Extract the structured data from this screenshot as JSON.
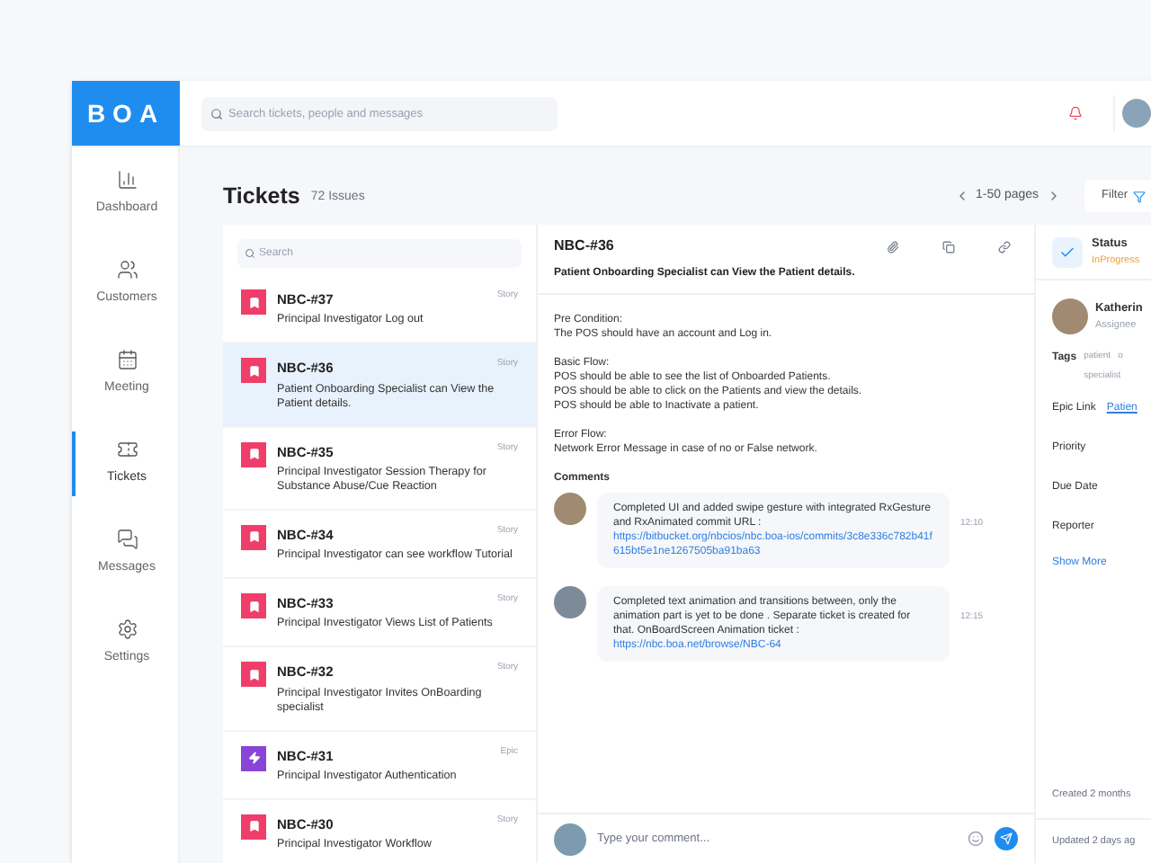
{
  "header": {
    "logo": "BOA",
    "search_placeholder": "Search tickets, people and messages"
  },
  "sidebar": [
    {
      "label": "Dashboard",
      "kind": "chart",
      "selected": false
    },
    {
      "label": "Customers",
      "kind": "users",
      "selected": false
    },
    {
      "label": "Meeting",
      "kind": "calendar",
      "selected": false
    },
    {
      "label": "Tickets",
      "kind": "ticket",
      "selected": true
    },
    {
      "label": "Messages",
      "kind": "messages",
      "selected": false
    },
    {
      "label": "Settings",
      "kind": "settings",
      "selected": false
    }
  ],
  "page": {
    "title": "Tickets",
    "count": "72 Issues",
    "pagination": "1-50 pages",
    "filter": "Filter"
  },
  "list": {
    "search_placeholder": "Search",
    "tickets": [
      {
        "id": "NBC-#37",
        "title": "Principal Investigator Log out",
        "type": "Story",
        "kind": "story",
        "selected": false
      },
      {
        "id": "NBC-#36",
        "title": "Patient Onboarding Specialist can View the Patient details.",
        "type": "Story",
        "kind": "story",
        "selected": true
      },
      {
        "id": "NBC-#35",
        "title": "Principal Investigator Session Therapy for Substance Abuse/Cue Reaction",
        "type": "Story",
        "kind": "story",
        "selected": false
      },
      {
        "id": "NBC-#34",
        "title": "Principal Investigator can see workflow Tutorial",
        "type": "Story",
        "kind": "story",
        "selected": false
      },
      {
        "id": "NBC-#33",
        "title": "Principal Investigator Views List of Patients",
        "type": "Story",
        "kind": "story",
        "selected": false
      },
      {
        "id": "NBC-#32",
        "title": "Principal Investigator Invites OnBoarding specialist",
        "type": "Story",
        "kind": "story",
        "selected": false
      },
      {
        "id": "NBC-#31",
        "title": "Principal Investigator Authentication",
        "type": "Epic",
        "kind": "epic",
        "selected": false
      },
      {
        "id": "NBC-#30",
        "title": "Principal Investigator Workflow",
        "type": "Story",
        "kind": "story",
        "selected": false
      }
    ]
  },
  "detail": {
    "id": "NBC-#36",
    "title": "Patient Onboarding Specialist can View the Patient details.",
    "sections": [
      {
        "heading": "Pre Condition:",
        "lines": [
          "The POS should have an account and Log in."
        ]
      },
      {
        "heading": "Basic Flow:",
        "lines": [
          "POS should be able to see the list of Onboarded Patients.",
          "POS should be able to click on the Patients and view the details.",
          "POS should be able to Inactivate a patient."
        ]
      },
      {
        "heading": "Error Flow:",
        "lines": [
          "Network Error Message in case of no or False network."
        ]
      }
    ],
    "comments_heading": "Comments",
    "comments": [
      {
        "text": "Completed UI and added swipe gesture with integrated RxGesture and RxAnimated commit URL :",
        "link": "https://bitbucket.org/nbcios/nbc.boa-ios/commits/3c8e336c782b41f615bt5e1ne1267505ba91ba63",
        "time": "12:10"
      },
      {
        "text": "Completed text animation and transitions between, only the animation part is yet to be done . Separate ticket is created for that. OnBoardScreen Animation ticket :",
        "link": "https://nbc.boa.net/browse/NBC-64",
        "time": "12:15"
      }
    ],
    "comment_placeholder": "Type your comment..."
  },
  "side": {
    "status_label": "Status",
    "status_value": "InProgress",
    "status_checked": true,
    "assignee": "Katherin",
    "assignee_role": "Assignee",
    "tags_label": "Tags",
    "tags": [
      "patient",
      "o",
      "specialist"
    ],
    "fields": [
      {
        "label": "Epic Link",
        "value": "Patien"
      },
      {
        "label": "Priority"
      },
      {
        "label": "Due Date"
      },
      {
        "label": "Reporter"
      }
    ],
    "show_more": "Show More",
    "created": "Created 2 months",
    "updated": "Updated 2 days ag"
  }
}
